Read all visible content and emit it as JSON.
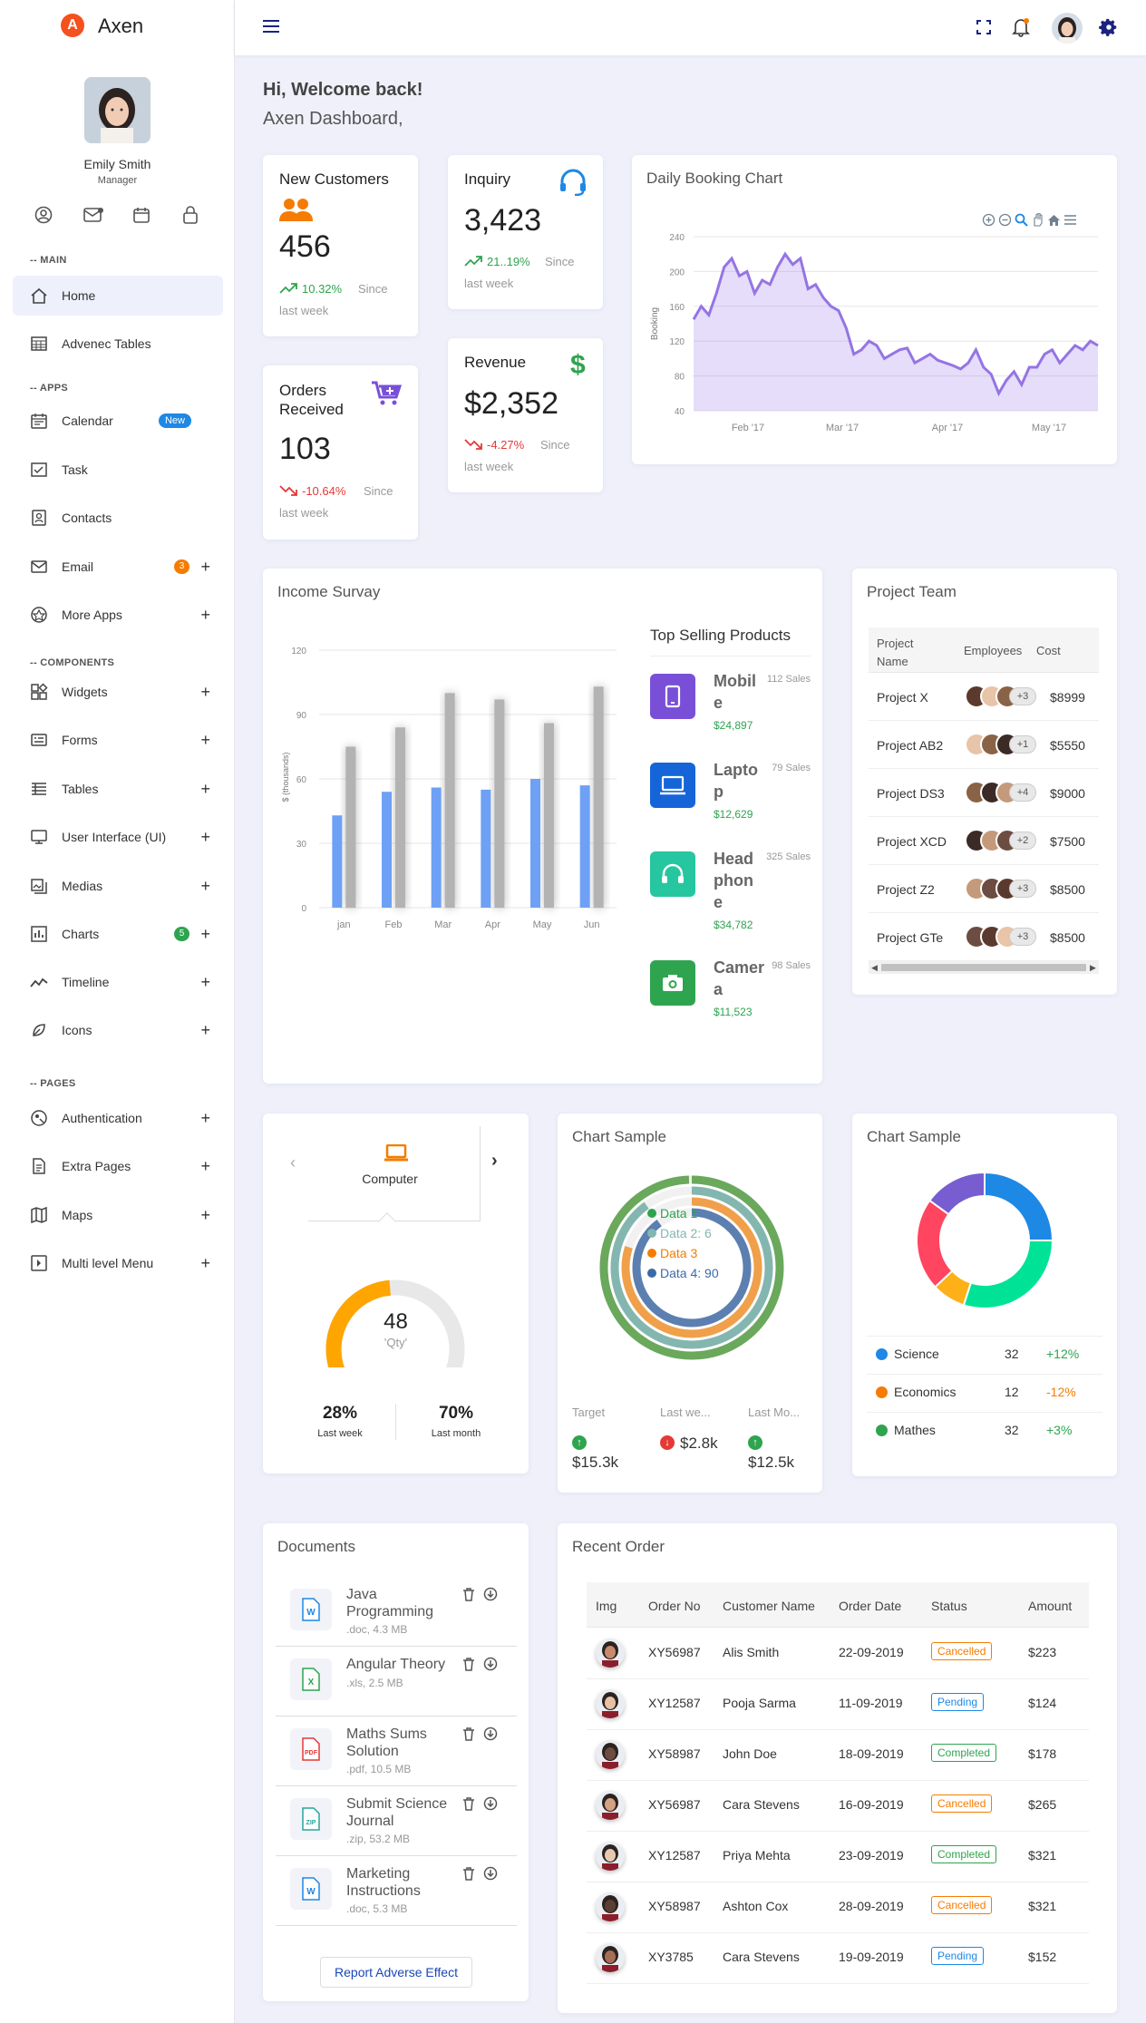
{
  "app": {
    "name": "Axen",
    "logo_letter": "A"
  },
  "user": {
    "name": "Emily Smith",
    "role": "Manager"
  },
  "sidebar": {
    "sections": {
      "main": "-- MAIN",
      "apps": "-- APPS",
      "components": "-- COMPONENTS",
      "pages": "-- PAGES"
    },
    "items": [
      {
        "label": "Home",
        "icon": "home-icon"
      },
      {
        "label": "Advenec Tables",
        "icon": "table-icon"
      },
      {
        "label": "Calendar",
        "icon": "calendar-icon",
        "badge": "New"
      },
      {
        "label": "Task",
        "icon": "task-icon"
      },
      {
        "label": "Contacts",
        "icon": "contacts-icon"
      },
      {
        "label": "Email",
        "icon": "email-icon",
        "badge": "3"
      },
      {
        "label": "More Apps",
        "icon": "apps-icon"
      },
      {
        "label": "Widgets",
        "icon": "widgets-icon"
      },
      {
        "label": "Forms",
        "icon": "forms-icon"
      },
      {
        "label": "Tables",
        "icon": "tables-icon"
      },
      {
        "label": "User Interface (UI)",
        "icon": "ui-icon"
      },
      {
        "label": "Medias",
        "icon": "media-icon"
      },
      {
        "label": "Charts",
        "icon": "charts-icon",
        "badge": "5"
      },
      {
        "label": "Timeline",
        "icon": "timeline-icon"
      },
      {
        "label": "Icons",
        "icon": "icons-icon"
      },
      {
        "label": "Authentication",
        "icon": "auth-icon"
      },
      {
        "label": "Extra Pages",
        "icon": "pages-icon"
      },
      {
        "label": "Maps",
        "icon": "map-icon"
      },
      {
        "label": "Multi level Menu",
        "icon": "menu-icon"
      }
    ]
  },
  "welcome": {
    "title": "Hi, Welcome back!",
    "subtitle": "Axen Dashboard,"
  },
  "stats": {
    "customers": {
      "title": "New Customers",
      "value": "456",
      "change": "10.32%",
      "since": "Since",
      "since2": "last week"
    },
    "inquiry": {
      "title": "Inquiry",
      "value": "3,423",
      "change": "21..19%",
      "since": "Since",
      "since2": "last week"
    },
    "orders": {
      "title": "Orders Received",
      "value": "103",
      "change": "-10.64%",
      "since": "Since",
      "since2": "last week"
    },
    "revenue": {
      "title": "Revenue",
      "value": "$2,352",
      "change": "-4.27%",
      "since": "Since",
      "since2": "last week"
    }
  },
  "daily_booking": {
    "title": "Daily Booking Chart",
    "ylabel": "Booking",
    "yticks": [
      "240",
      "200",
      "160",
      "120",
      "80",
      "40"
    ],
    "xticks": [
      "Feb '17",
      "Mar '17",
      "Apr '17",
      "May '17"
    ]
  },
  "income": {
    "title": "Income Survay",
    "ylabel": "$ (thousands)",
    "yticks": [
      "120",
      "90",
      "60",
      "30",
      "0"
    ]
  },
  "top_selling": {
    "title": "Top Selling Products",
    "products": [
      {
        "name1": "Mobil",
        "name2": "e",
        "price": "$24,897",
        "sales": "112 Sales",
        "color": "#7a4fd8"
      },
      {
        "name1": "Lapto",
        "name2": "p",
        "price": "$12,629",
        "sales": "79 Sales",
        "color": "#1565d8"
      },
      {
        "name1": "Head",
        "name2": "phon",
        "name3": "e",
        "price": "$34,782",
        "sales": "325 Sales",
        "color": "#26c6a0"
      },
      {
        "name1": "Camer",
        "name2": "a",
        "price": "$11,523",
        "sales": "98 Sales",
        "color": "#2ea44f"
      }
    ]
  },
  "project_team": {
    "title": "Project Team",
    "headers": [
      "Project Name",
      "Employees",
      "Cost"
    ],
    "rows": [
      {
        "name": "Project X",
        "more": "+3",
        "cost": "$8999"
      },
      {
        "name": "Project AB2",
        "more": "+1",
        "cost": "$5550"
      },
      {
        "name": "Project DS3",
        "more": "+4",
        "cost": "$9000"
      },
      {
        "name": "Project XCD",
        "more": "+2",
        "cost": "$7500"
      },
      {
        "name": "Project Z2",
        "more": "+3",
        "cost": "$8500"
      },
      {
        "name": "Project GTe",
        "more": "+3",
        "cost": "$8500"
      }
    ]
  },
  "gauge": {
    "tab": "Computer",
    "value": "48",
    "unit": "'Qty'",
    "stat1": "28%",
    "stat1_label": "Last week",
    "stat2": "70%",
    "stat2_label": "Last month",
    "fraction": 0.48
  },
  "radial": {
    "title": "Chart Sample",
    "legend": [
      "Data 1",
      "Data 2: 6",
      "Data 3",
      "Data 4: 90"
    ],
    "stats": [
      {
        "label": "Target",
        "value": "$15.3k",
        "dir": "up"
      },
      {
        "label": "Last we...",
        "value": "$2.8k",
        "dir": "down"
      },
      {
        "label": "Last Mo...",
        "value": "$12.5k",
        "dir": "up"
      }
    ]
  },
  "donut": {
    "title": "Chart Sample",
    "rows": [
      {
        "name": "Science",
        "value": "32",
        "change": "+12%",
        "color": "#1e88e5",
        "cc": "#2ea44f"
      },
      {
        "name": "Economics",
        "value": "12",
        "change": "-12%",
        "color": "#f57c00",
        "cc": "#f57c00"
      },
      {
        "name": "Mathes",
        "value": "32",
        "change": "+3%",
        "color": "#2ea44f",
        "cc": "#2ea44f"
      }
    ]
  },
  "documents": {
    "title": "Documents",
    "button": "Report Adverse Effect",
    "items": [
      {
        "name1": "Java",
        "name2": "Programming",
        "meta": ".doc, 4.3 MB",
        "type": "W",
        "color": "#1e88e5"
      },
      {
        "name1": "Angular Theory",
        "name2": "",
        "meta": ".xls, 2.5 MB",
        "type": "X",
        "color": "#2ea44f"
      },
      {
        "name1": "Maths Sums",
        "name2": "Solution",
        "meta": ".pdf, 10.5 MB",
        "type": "PDF",
        "color": "#e53935"
      },
      {
        "name1": "Submit Science",
        "name2": "Journal",
        "meta": ".zip, 53.2 MB",
        "type": "ZIP",
        "color": "#26a69a"
      },
      {
        "name1": "Marketing",
        "name2": "Instructions",
        "meta": ".doc, 5.3 MB",
        "type": "W",
        "color": "#1e88e5"
      }
    ]
  },
  "recent_order": {
    "title": "Recent Order",
    "headers": [
      "Img",
      "Order No",
      "Customer Name",
      "Order Date",
      "Status",
      "Amount"
    ],
    "rows": [
      {
        "no": "XY56987",
        "name": "Alis Smith",
        "date": "22-09-2019",
        "status": "Cancelled",
        "amount": "$223"
      },
      {
        "no": "XY12587",
        "name": "Pooja Sarma",
        "date": "11-09-2019",
        "status": "Pending",
        "amount": "$124"
      },
      {
        "no": "XY58987",
        "name": "John Doe",
        "date": "18-09-2019",
        "status": "Completed",
        "amount": "$178"
      },
      {
        "no": "XY56987",
        "name": "Cara Stevens",
        "date": "16-09-2019",
        "status": "Cancelled",
        "amount": "$265"
      },
      {
        "no": "XY12587",
        "name": "Priya Mehta",
        "date": "23-09-2019",
        "status": "Completed",
        "amount": "$321"
      },
      {
        "no": "XY58987",
        "name": "Ashton Cox",
        "date": "28-09-2019",
        "status": "Cancelled",
        "amount": "$321"
      },
      {
        "no": "XY3785",
        "name": "Cara Stevens",
        "date": "19-09-2019",
        "status": "Pending",
        "amount": "$152"
      }
    ]
  },
  "chart_data": [
    {
      "type": "area",
      "title": "Daily Booking Chart",
      "ylabel": "Booking",
      "ylim": [
        40,
        240
      ],
      "x": [
        "Feb '17",
        "Mar '17",
        "Apr '17",
        "May '17"
      ],
      "values": [
        145,
        160,
        150,
        175,
        205,
        215,
        195,
        200,
        175,
        190,
        185,
        205,
        220,
        208,
        215,
        180,
        185,
        170,
        160,
        155,
        135,
        105,
        110,
        120,
        115,
        100,
        105,
        110,
        112,
        95,
        100,
        105,
        98,
        95,
        92,
        88,
        95,
        110,
        90,
        82,
        60,
        75,
        85,
        70,
        90,
        90,
        105,
        110,
        95,
        105,
        115,
        110,
        120,
        115
      ]
    },
    {
      "type": "bar",
      "title": "Income Survay",
      "ylabel": "$ (thousands)",
      "ylim": [
        0,
        120
      ],
      "categories": [
        "jan",
        "Feb",
        "Mar",
        "Apr",
        "May",
        "Jun"
      ],
      "series": [
        {
          "values": [
            43,
            54,
            56,
            55,
            60,
            57
          ]
        },
        {
          "values": [
            75,
            84,
            100,
            97,
            86,
            103
          ]
        }
      ]
    },
    {
      "type": "pie",
      "title": "Chart Sample",
      "categories": [
        "Data 1",
        "Data 2: 6",
        "Data 3",
        "Data 4: 90"
      ],
      "values": [
        100,
        90,
        80,
        90
      ]
    },
    {
      "type": "pie",
      "title": "Chart Sample",
      "values": [
        25,
        30,
        8,
        22,
        15
      ]
    }
  ]
}
